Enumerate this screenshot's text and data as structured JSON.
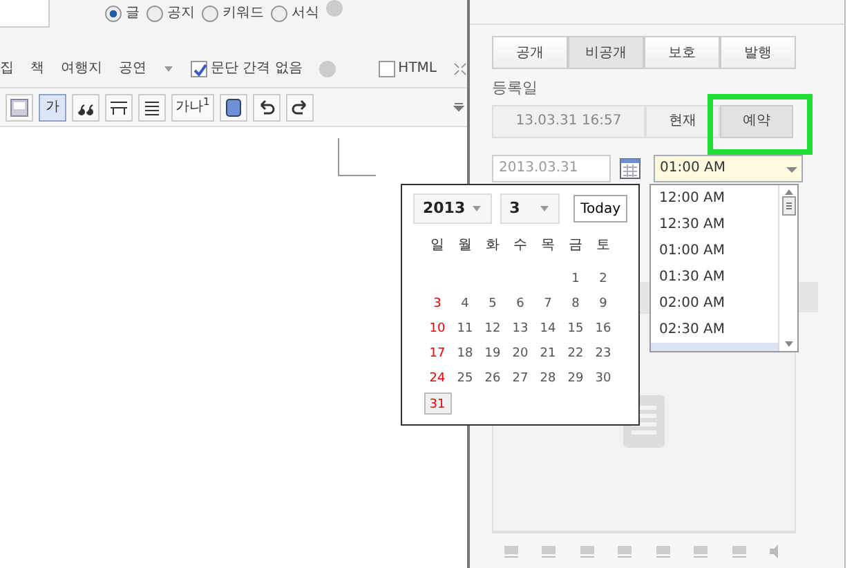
{
  "post_types": [
    {
      "label": "글",
      "selected": true
    },
    {
      "label": "공지",
      "selected": false
    },
    {
      "label": "키워드",
      "selected": false
    },
    {
      "label": "서식",
      "selected": false,
      "help": true
    }
  ],
  "categories": [
    "집",
    "책",
    "여행지",
    "공연"
  ],
  "options": [
    {
      "label": "문단 간격 없음",
      "checked": true,
      "help": true
    },
    {
      "label": "HTML",
      "checked": false,
      "help": false
    }
  ],
  "toolbar": [
    {
      "kind": "image"
    },
    {
      "kind": "text",
      "label": "가",
      "selected": true
    },
    {
      "kind": "quote"
    },
    {
      "kind": "rule"
    },
    {
      "kind": "lines"
    },
    {
      "kind": "text",
      "label": "가나$^{1}$",
      "selected": false
    },
    {
      "kind": "box"
    },
    {
      "kind": "undo"
    },
    {
      "kind": "redo"
    }
  ],
  "visibility_tabs": [
    {
      "label": "공개",
      "selected": false
    },
    {
      "label": "비공개",
      "selected": true
    },
    {
      "label": "보호",
      "selected": false
    },
    {
      "label": "발행",
      "selected": false
    }
  ],
  "date_label": "등록일",
  "current_datetime": "13.03.31 16:57",
  "date_modes": [
    {
      "label": "현재",
      "selected": false
    },
    {
      "label": "예약",
      "selected": true
    }
  ],
  "date_input": "2013.03.31",
  "time_select": {
    "value": "01:00 AM",
    "open": true,
    "options": [
      "12:00 AM",
      "12:30 AM",
      "01:00 AM",
      "01:30 AM",
      "02:00 AM",
      "02:30 AM"
    ]
  },
  "calendar": {
    "year": "2013",
    "month": "3",
    "today_button": "Today",
    "weekdays": [
      "일",
      "월",
      "화",
      "수",
      "목",
      "금",
      "토"
    ],
    "weeks": [
      {
        "kind": "right",
        "days": [
          {
            "label": "1",
            "selected": false
          },
          {
            "label": "2",
            "selected": false
          }
        ]
      },
      {
        "kind": "left",
        "days": [
          {
            "label": "3",
            "selected": false
          },
          {
            "label": "4",
            "selected": false
          },
          {
            "label": "5",
            "selected": false
          },
          {
            "label": "6",
            "selected": false
          },
          {
            "label": "7",
            "selected": false
          },
          {
            "label": "8",
            "selected": false
          },
          {
            "label": "9",
            "selected": false
          }
        ]
      },
      {
        "kind": "left",
        "days": [
          {
            "label": "10",
            "selected": false
          },
          {
            "label": "11",
            "selected": false
          },
          {
            "label": "12",
            "selected": false
          },
          {
            "label": "13",
            "selected": false
          },
          {
            "label": "14",
            "selected": false
          },
          {
            "label": "15",
            "selected": false
          },
          {
            "label": "16",
            "selected": false
          }
        ]
      },
      {
        "kind": "left",
        "days": [
          {
            "label": "17",
            "selected": false
          },
          {
            "label": "18",
            "selected": false
          },
          {
            "label": "19",
            "selected": false
          },
          {
            "label": "20",
            "selected": false
          },
          {
            "label": "21",
            "selected": false
          },
          {
            "label": "22",
            "selected": false
          },
          {
            "label": "23",
            "selected": false
          }
        ]
      },
      {
        "kind": "left",
        "days": [
          {
            "label": "24",
            "selected": false
          },
          {
            "label": "25",
            "selected": false
          },
          {
            "label": "26",
            "selected": false
          },
          {
            "label": "27",
            "selected": false
          },
          {
            "label": "28",
            "selected": false
          },
          {
            "label": "29",
            "selected": false
          },
          {
            "label": "30",
            "selected": false
          }
        ]
      },
      {
        "kind": "left",
        "days": [
          {
            "label": "31",
            "selected": true
          }
        ]
      }
    ]
  }
}
